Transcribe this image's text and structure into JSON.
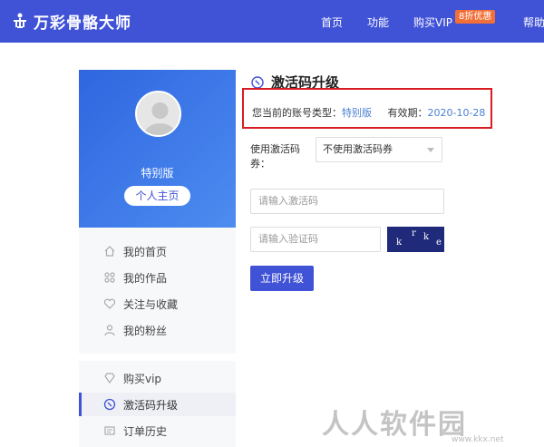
{
  "header": {
    "logo_text": "万彩骨骼大师",
    "nav": [
      "首页",
      "功能",
      "购买VIP",
      "帮助"
    ],
    "promo_badge": "8折优惠",
    "background_color": "#4052d6"
  },
  "sidebar": {
    "username": "特别版",
    "home_button": "个人主页",
    "items": [
      {
        "label": "我的首页",
        "icon": "home-icon"
      },
      {
        "label": "我的作品",
        "icon": "grid-icon"
      },
      {
        "label": "关注与收藏",
        "icon": "heart-icon"
      },
      {
        "label": "我的粉丝",
        "icon": "user-icon"
      },
      {
        "label": "购买vip",
        "icon": "diamond-icon"
      },
      {
        "label": "激活码升级",
        "icon": "activation-icon",
        "active": true
      },
      {
        "label": "订单历史",
        "icon": "order-icon"
      }
    ]
  },
  "main": {
    "title": "激活码升级",
    "account_type_label": "您当前的账号类型：",
    "account_type_value": "特别版",
    "expiry_label": "有效期：",
    "expiry_value": "2020-10-28",
    "coupon_label": "使用激活码券：",
    "coupon_select_value": "不使用激活码券",
    "activation_placeholder": "请输入激活码",
    "captcha_placeholder": "请输入验证码",
    "captcha_text": [
      "k",
      "r",
      "k",
      "e"
    ],
    "submit_label": "立即升级"
  },
  "watermark": {
    "text": "人人软件园",
    "url": "www.kkx.net"
  }
}
